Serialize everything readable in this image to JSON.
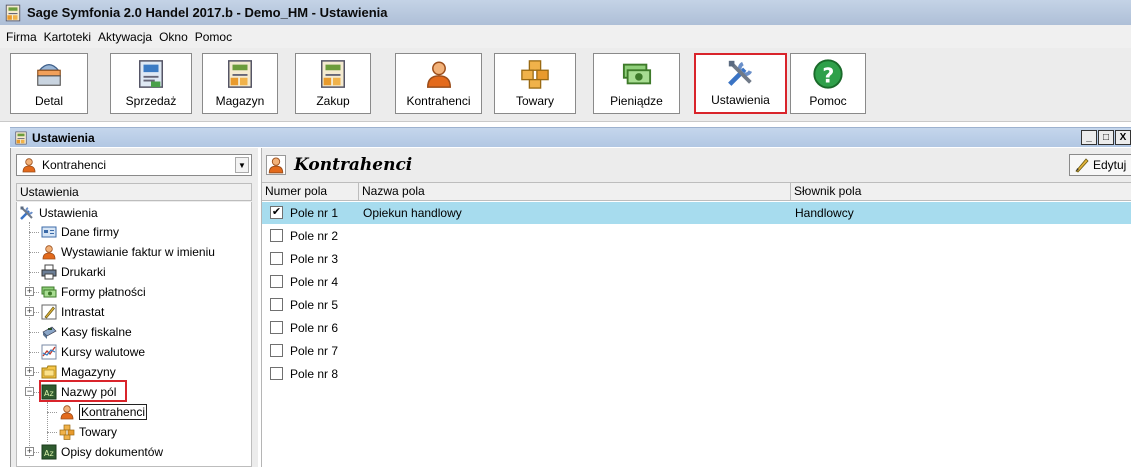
{
  "window": {
    "title": "Sage Symfonia 2.0 Handel 2017.b - Demo_HM - Ustawienia"
  },
  "menu": [
    "Firma",
    "Kartoteki",
    "Aktywacja",
    "Okno",
    "Pomoc"
  ],
  "toolbar": {
    "buttons": [
      {
        "label": "Detal",
        "icon": "cash-register-icon"
      },
      {
        "label": "Sprzedaż",
        "icon": "invoice-icon"
      },
      {
        "label": "Magazyn",
        "icon": "warehouse-icon"
      },
      {
        "label": "Zakup",
        "icon": "purchase-icon"
      },
      {
        "label": "Kontrahenci",
        "icon": "person-icon"
      },
      {
        "label": "Towary",
        "icon": "boxes-icon"
      },
      {
        "label": "Pieniądze",
        "icon": "money-icon"
      },
      {
        "label": "Ustawienia",
        "icon": "tools-icon",
        "active": true
      },
      {
        "label": "Pomoc",
        "icon": "help-icon"
      }
    ]
  },
  "child_window": {
    "title": "Ustawienia",
    "controls": [
      "_",
      "□",
      "X"
    ]
  },
  "left_panel": {
    "combo_value": "Kontrahenci",
    "tree_header": "Ustawienia",
    "tree": [
      {
        "label": "Ustawienia",
        "icon": "tools-icon"
      },
      {
        "label": "Dane firmy",
        "icon": "company-icon"
      },
      {
        "label": "Wystawianie faktur w imieniu",
        "icon": "person-icon"
      },
      {
        "label": "Drukarki",
        "icon": "printer-icon",
        "expander": "+"
      },
      {
        "label": "Formy płatności",
        "icon": "money-icon",
        "expander": "+"
      },
      {
        "label": "Intrastat",
        "icon": "pencil-icon"
      },
      {
        "label": "Kasy fiskalne",
        "icon": "cash-register-icon"
      },
      {
        "label": "Kursy walutowe",
        "icon": "chart-icon"
      },
      {
        "label": "Magazyny",
        "icon": "folder-icon",
        "expander": "+"
      },
      {
        "label": "Nazwy pól",
        "icon": "field-names-icon",
        "expander": "−"
      },
      {
        "label": "Kontrahenci",
        "icon": "person-icon",
        "selected": true
      },
      {
        "label": "Towary",
        "icon": "boxes-icon"
      },
      {
        "label": "Opisy dokumentów",
        "icon": "field-names-icon",
        "expander": "+"
      }
    ]
  },
  "right_panel": {
    "title": "Kontrahenci",
    "edit_label": "Edytuj",
    "columns": [
      "Numer pola",
      "Nazwa pola",
      "Słownik pola"
    ],
    "rows": [
      {
        "checked": true,
        "numer": "Pole nr  1",
        "nazwa": "Opiekun handlowy",
        "slownik": "Handlowcy"
      },
      {
        "checked": false,
        "numer": "Pole nr  2",
        "nazwa": "",
        "slownik": ""
      },
      {
        "checked": false,
        "numer": "Pole nr  3",
        "nazwa": "",
        "slownik": ""
      },
      {
        "checked": false,
        "numer": "Pole nr  4",
        "nazwa": "",
        "slownik": ""
      },
      {
        "checked": false,
        "numer": "Pole nr  5",
        "nazwa": "",
        "slownik": ""
      },
      {
        "checked": false,
        "numer": "Pole nr  6",
        "nazwa": "",
        "slownik": ""
      },
      {
        "checked": false,
        "numer": "Pole nr  7",
        "nazwa": "",
        "slownik": ""
      },
      {
        "checked": false,
        "numer": "Pole nr  8",
        "nazwa": "",
        "slownik": ""
      }
    ]
  },
  "colors": {
    "highlight_row": "#a7dcee",
    "annotation_red": "#d9242b"
  }
}
